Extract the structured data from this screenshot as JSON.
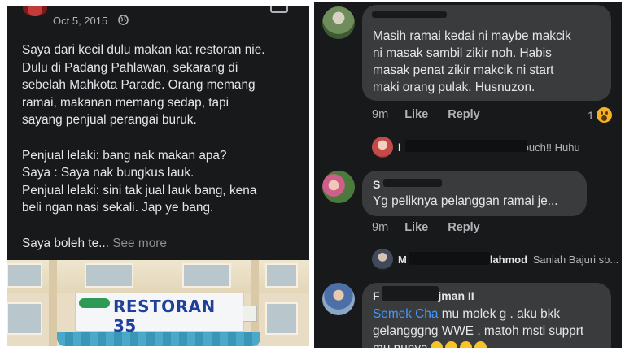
{
  "left_post": {
    "date": "Oct 5, 2015",
    "privacy_icon": "globe-icon",
    "body": "Saya dari kecil dulu makan kat restoran nie.\nDulu di Padang Pahlawan, sekarang di\nsebelah Mahkota Parade. Orang memang\nramai, makanan memang sedap, tapi\nsayang penjual perangai buruk.\n\nPenjual lelaki: bang nak makan apa?\nSaya : Saya nak bungkus lauk.\nPenjual lelaki: sini tak jual lauk bang, kena\nbeli ngan nasi sekali. Jap ye bang.\n\nSaya boleh te...",
    "see_more": "See more",
    "photo": {
      "sign_title": "RESTORAN 35"
    }
  },
  "comments": [
    {
      "name": "",
      "text": "Masih ramai kedai ni maybe makcik\nni masak sambil zikir noh. Habis\nmasak penat zikir makcik ni start\nmaki orang pulak. Husnuzon.",
      "time": "9m",
      "like": "Like",
      "reply": "Reply",
      "reaction_count": "1",
      "reaction_icon": "wow-emoji-icon",
      "reply_preview": "ouch!! Huhu"
    },
    {
      "name": "S",
      "text": "Yg peliknya pelanggan ramai je...",
      "time": "9m",
      "like": "Like",
      "reply": "Reply",
      "reply_preview_name": "M",
      "reply_preview_name_tail": "lahmod",
      "reply_preview_text": "Saniah Bajuri sb..."
    },
    {
      "name": "F",
      "name_tail": "ajman II",
      "mention": "Semek Cha",
      "text": " mu molek g . aku bkk\ngelangggng WWE . matoh msti supprt\nmu nunya"
    }
  ],
  "colors": {
    "panel_bg": "#18191a",
    "bubble_bg": "#3a3b3c",
    "text_primary": "#e4e6eb",
    "text_secondary": "#b0b3b8",
    "mention": "#4599ff",
    "reaction_yellow": "#f7b125"
  }
}
